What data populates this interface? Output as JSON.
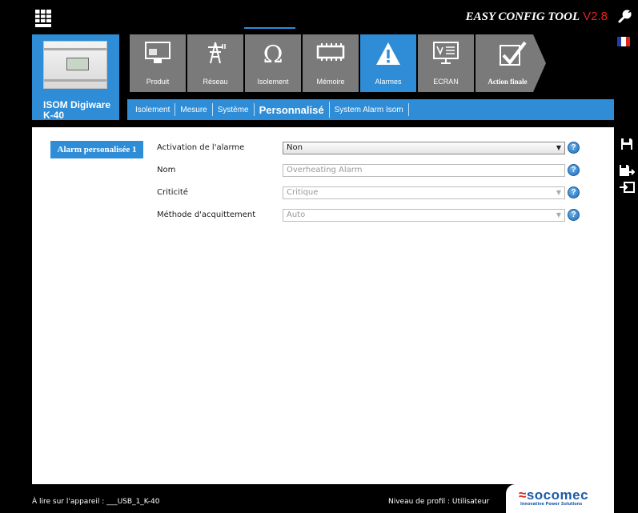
{
  "app": {
    "title": "EASY CONFIG TOOL",
    "version": "V2.8"
  },
  "device": {
    "name": "ISOM Digiware K-40"
  },
  "nav": {
    "tiles": [
      {
        "label": "Produit",
        "icon": "monitor-icon"
      },
      {
        "label": "Réseau",
        "icon": "power-pylon-icon"
      },
      {
        "label": "Isolement",
        "icon": "ohm-icon"
      },
      {
        "label": "Mémoire",
        "icon": "memory-chip-icon"
      },
      {
        "label": "Alarmes",
        "icon": "warning-icon",
        "active": true
      },
      {
        "label": "ECRAN",
        "icon": "screen-presentation-icon"
      },
      {
        "label": "Action finale",
        "icon": "checkmark-icon"
      }
    ]
  },
  "subnav": {
    "tabs": [
      {
        "label": "Isolement"
      },
      {
        "label": "Mesure"
      },
      {
        "label": "Système"
      },
      {
        "label": "Personnalisé",
        "active": true
      },
      {
        "label": "System Alarm Isom"
      }
    ]
  },
  "side_icons": [
    "save-icon",
    "save-as-icon",
    "export-icon"
  ],
  "alarm": {
    "button_label": "Alarm personalisée 1"
  },
  "form": {
    "fields": [
      {
        "label": "Activation de l'alarme",
        "value": "Non",
        "type": "select",
        "enabled": true
      },
      {
        "label": "Nom",
        "value": "Overheating Alarm",
        "type": "text",
        "enabled": false
      },
      {
        "label": "Criticité",
        "value": "Critique",
        "type": "select",
        "enabled": false
      },
      {
        "label": "Méthode d'acquittement",
        "value": "Auto",
        "type": "select",
        "enabled": false
      }
    ],
    "help_symbol": "?"
  },
  "footer": {
    "device_read": "À lire sur l'appareil : ___USB_1_K-40",
    "profile": "Niveau de profil : Utilisateur"
  },
  "brand": {
    "name": "socomec",
    "tagline": "Innovative Power Solutions"
  },
  "colors": {
    "accent": "#2e8dd6",
    "tile_gray": "#7a7a7a",
    "version_red": "#e2231a",
    "brand_blue": "#1e5aa8"
  }
}
